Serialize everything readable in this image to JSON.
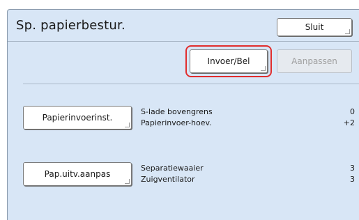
{
  "window": {
    "title": "Sp. papierbestur.",
    "close_label": "Sluit"
  },
  "toolbar": {
    "feed_button": "Invoer/Bel",
    "adjust_button": "Aanpassen"
  },
  "sections": [
    {
      "button": "Papierinvoerinst.",
      "rows": [
        {
          "label": "S-lade bovengrens",
          "value": "0"
        },
        {
          "label": "Papierinvoer-hoev.",
          "value": "+2"
        }
      ]
    },
    {
      "button": "Pap.uitv.aanpas",
      "rows": [
        {
          "label": "Separatiewaaier",
          "value": "3"
        },
        {
          "label": "Zuigventilator",
          "value": "3"
        }
      ]
    }
  ],
  "colors": {
    "panel": "#d8e6f6",
    "highlight": "#e12d2d"
  }
}
